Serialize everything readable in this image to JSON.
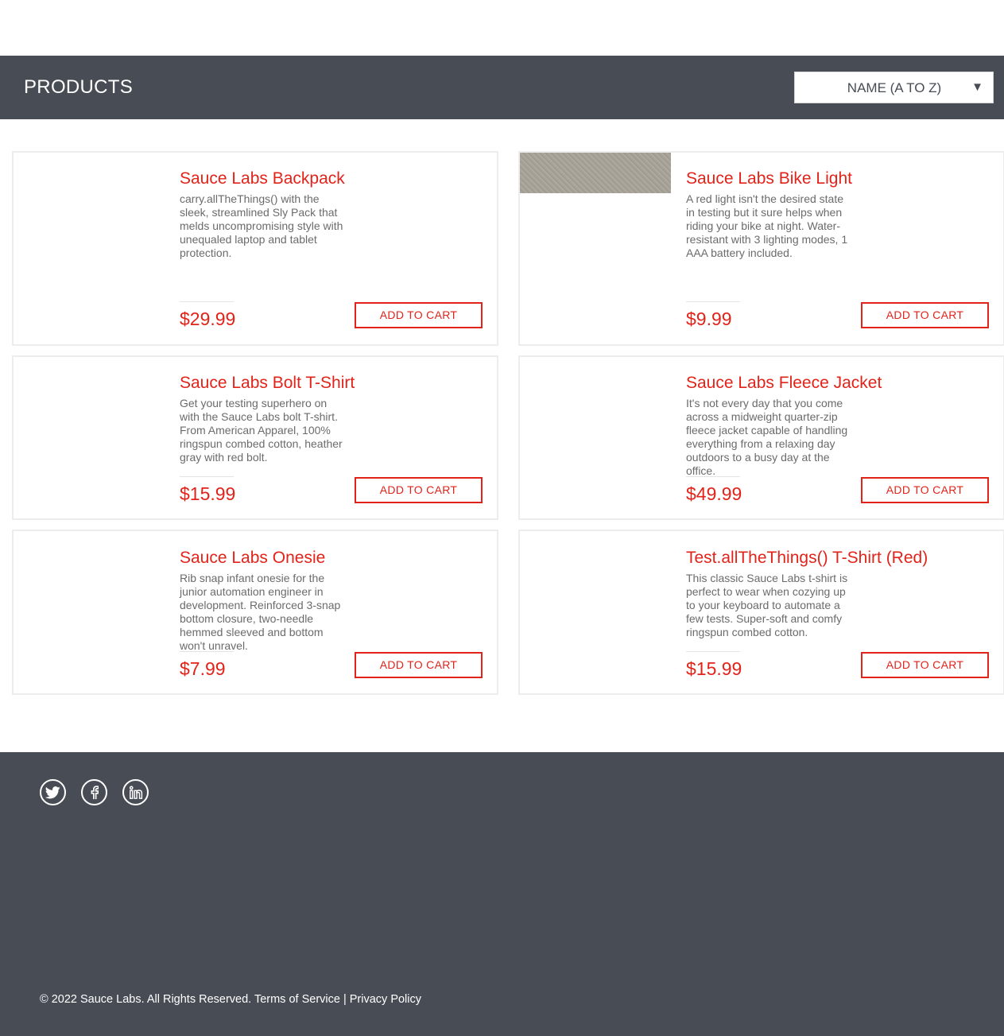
{
  "header": {
    "title": "PRODUCTS",
    "sort": {
      "selected": "NAME (A TO Z)"
    }
  },
  "products": [
    {
      "name": "Sauce Labs Backpack",
      "description": "carry.allTheThings() with the sleek, streamlined Sly Pack that melds uncompromising style with unequaled laptop and tablet protection.",
      "price": "$29.99",
      "button": "ADD TO CART"
    },
    {
      "name": "Sauce Labs Bike Light",
      "description": "A red light isn't the desired state in testing but it sure helps when riding your bike at night. Water-resistant with 3 lighting modes, 1 AAA battery included.",
      "price": "$9.99",
      "button": "ADD TO CART"
    },
    {
      "name": "Sauce Labs Bolt T-Shirt",
      "description": "Get your testing superhero on with the Sauce Labs bolt T-shirt. From American Apparel, 100% ringspun combed cotton, heather gray with red bolt.",
      "price": "$15.99",
      "button": "ADD TO CART"
    },
    {
      "name": "Sauce Labs Fleece Jacket",
      "description": "It's not every day that you come across a midweight quarter-zip fleece jacket capable of handling everything from a relaxing day outdoors to a busy day at the office.",
      "price": "$49.99",
      "button": "ADD TO CART"
    },
    {
      "name": "Sauce Labs Onesie",
      "description": "Rib snap infant onesie for the junior automation engineer in development. Reinforced 3-snap bottom closure, two-needle hemmed sleeved and bottom won't unravel.",
      "price": "$7.99",
      "button": "ADD TO CART"
    },
    {
      "name": "Test.allTheThings() T-Shirt (Red)",
      "description": "This classic Sauce Labs t-shirt is perfect to wear when cozying up to your keyboard to automate a few tests. Super-soft and comfy ringspun combed cotton.",
      "price": "$15.99",
      "button": "ADD TO CART"
    }
  ],
  "footer": {
    "social": [
      "twitter-icon",
      "facebook-icon",
      "linkedin-icon"
    ],
    "copyright": "© 2022 Sauce Labs. All Rights Reserved. Terms of Service | Privacy Policy"
  },
  "colors": {
    "accent": "#e2231a",
    "header_bg": "#484c55",
    "footer_bg": "#484c55"
  }
}
